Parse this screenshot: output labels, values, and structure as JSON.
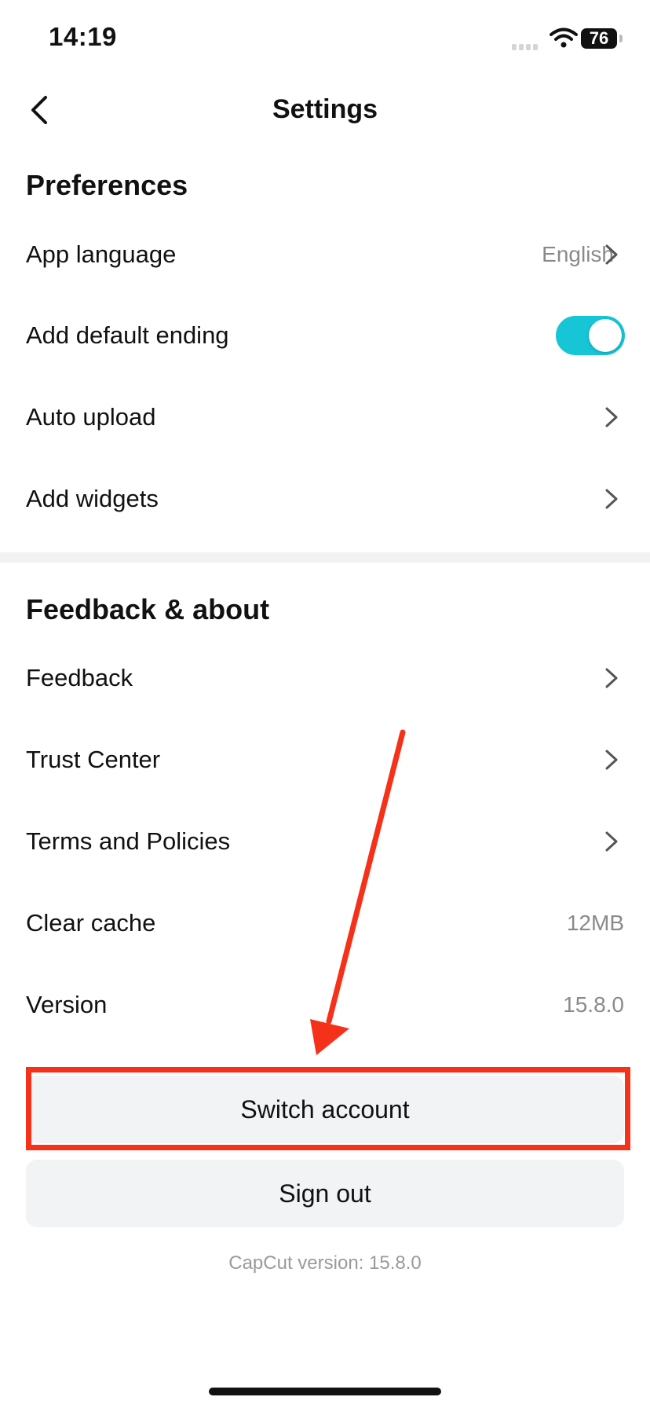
{
  "status_bar": {
    "time": "14:19",
    "battery": "76"
  },
  "nav": {
    "title": "Settings"
  },
  "preferences": {
    "title": "Preferences",
    "items": [
      {
        "label": "App language",
        "value": "English",
        "control": "chevron"
      },
      {
        "label": "Add default ending",
        "control": "toggle",
        "toggle_on": true
      },
      {
        "label": "Auto upload",
        "control": "chevron"
      },
      {
        "label": "Add widgets",
        "control": "chevron"
      }
    ]
  },
  "feedback": {
    "title": "Feedback & about",
    "items": [
      {
        "label": "Feedback",
        "control": "chevron"
      },
      {
        "label": "Trust Center",
        "control": "chevron"
      },
      {
        "label": "Terms and Policies",
        "control": "chevron"
      },
      {
        "label": "Clear cache",
        "value": "12MB"
      },
      {
        "label": "Version",
        "value": "15.8.0"
      }
    ]
  },
  "buttons": {
    "switch_account": "Switch account",
    "sign_out": "Sign out"
  },
  "footer": {
    "version_text": "CapCut version: 15.8.0"
  },
  "colors": {
    "accent": "#16c5d6",
    "annotation": "#f5311a",
    "button_bg": "#f2f3f5"
  }
}
